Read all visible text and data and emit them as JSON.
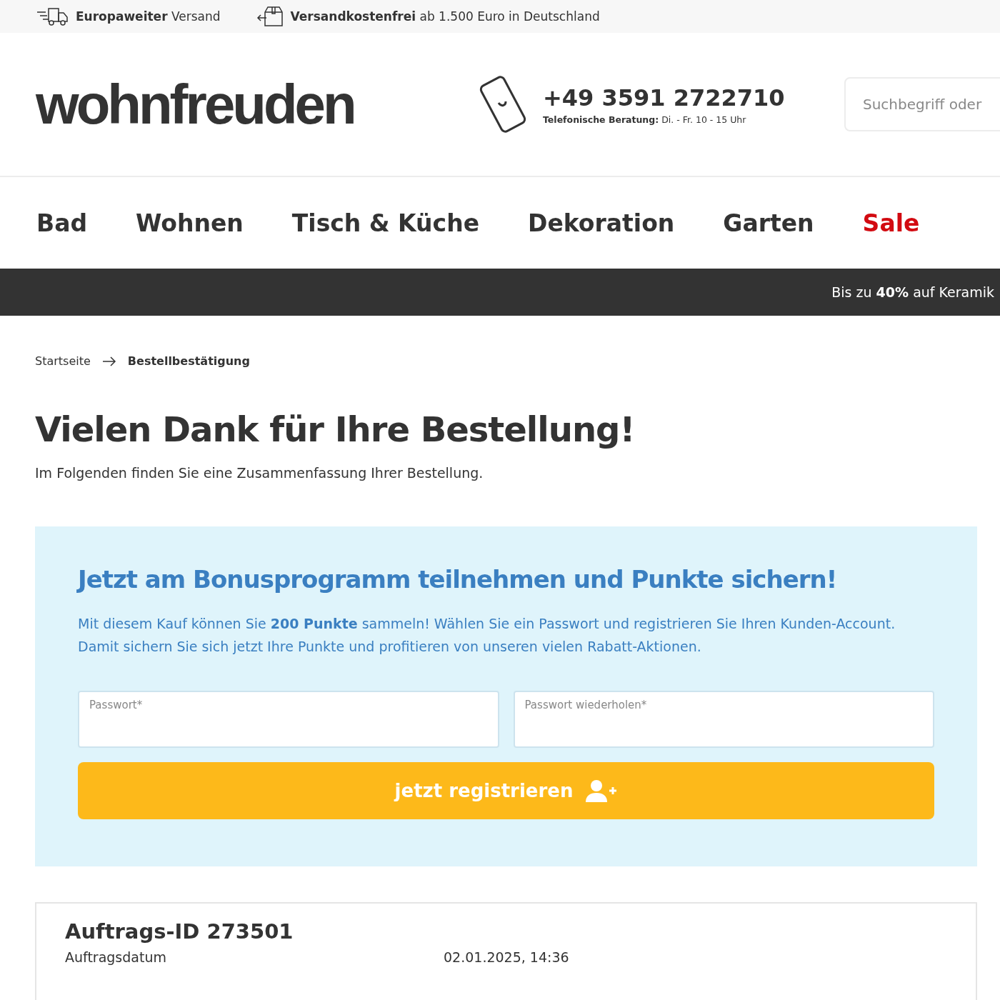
{
  "top_bar": [
    {
      "kind": "truck",
      "text": "**Europaweiter** Versand"
    },
    {
      "kind": "box",
      "text": "**Versandkostenfrei** ab 1.500 Euro in Deutschland"
    }
  ],
  "header": {
    "logo": "wohnfreuden",
    "phone": "+49 3591 2722710",
    "hours": "**Telefonische Beratung:** Di. - Fr. 10 - 15 Uhr",
    "search": {
      "placeholder": "Suchbegriff oder"
    }
  },
  "nav": [
    {
      "label": "Bad",
      "highlight": false
    },
    {
      "label": "Wohnen",
      "highlight": false
    },
    {
      "label": "Tisch & Küche",
      "highlight": false
    },
    {
      "label": "Dekoration",
      "highlight": false
    },
    {
      "label": "Garten",
      "highlight": false
    },
    {
      "label": "Sale",
      "highlight": true
    }
  ],
  "promo_banner": "Bis zu **40%** auf Keramik",
  "breadcrumb": [
    "Startseite",
    "Bestellbestätigung"
  ],
  "title": "Vielen Dank für Ihre Bestellung!",
  "subtitle": "Im Folgenden finden Sie eine Zusammenfassung Ihrer Bestellung.",
  "bonus": {
    "title": "Jetzt am Bonusprogramm teilnehmen und Punkte sichern!",
    "text": "Mit diesem Kauf können Sie **200 Punkte** sammeln! Wählen Sie ein Passwort und registrieren Sie Ihren Kunden-Account. Damit sichern Sie sich jetzt Ihre Punkte und profitieren von unseren vielen Rabatt-Aktionen.",
    "fields": [
      {
        "placeholder": "Passwort*"
      },
      {
        "placeholder": "Passwort wiederholen*"
      }
    ],
    "button": "jetzt registrieren"
  },
  "order": {
    "title": "Auftrags-ID 273501",
    "rows": [
      {
        "label": "Auftragsdatum",
        "value": "02.01.2025, 14:36"
      }
    ]
  }
}
